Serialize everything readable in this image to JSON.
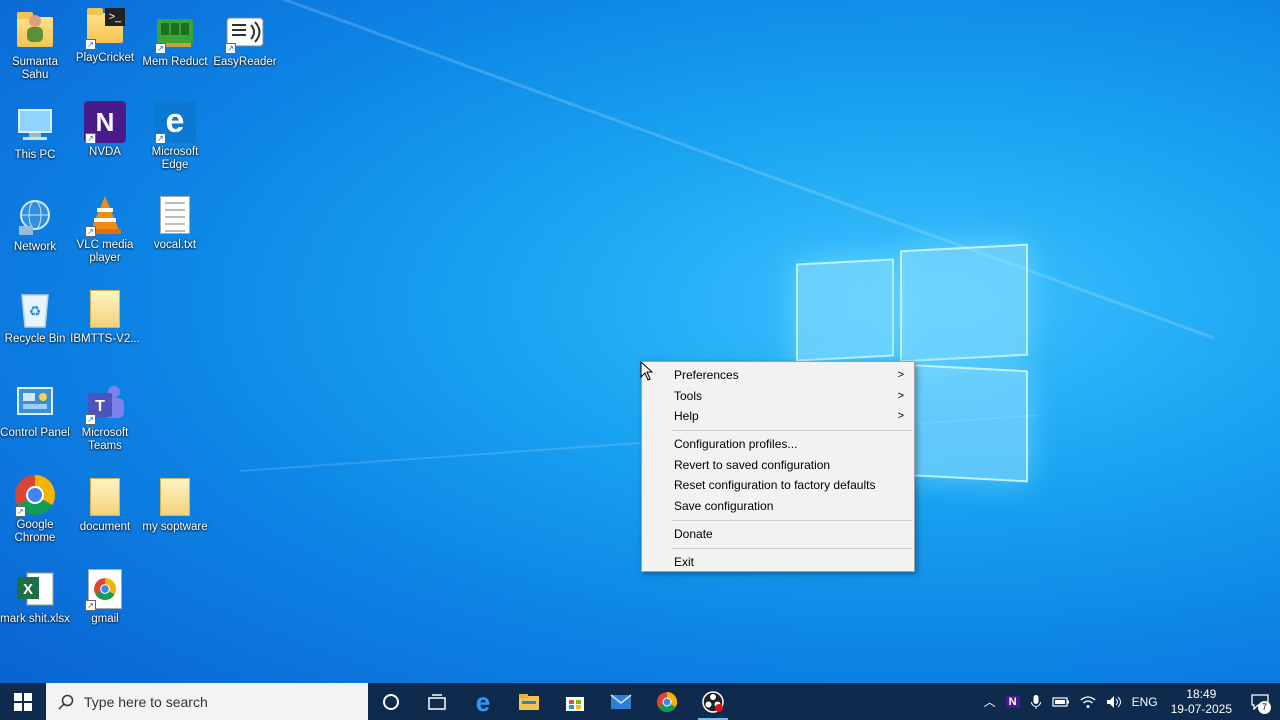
{
  "desktop": {
    "icons": [
      {
        "label": "Sumanta Sahu",
        "icon": "user-folder-icon"
      },
      {
        "label": "PlayCricket",
        "icon": "folder-app-icon"
      },
      {
        "label": "Mem Reduct",
        "icon": "memory-icon"
      },
      {
        "label": "EasyReader",
        "icon": "reader-icon"
      },
      {
        "label": "This PC",
        "icon": "computer-icon"
      },
      {
        "label": "NVDA",
        "icon": "nvda-icon"
      },
      {
        "label": "Microsoft Edge",
        "icon": "edge-icon"
      },
      {
        "label": "Network",
        "icon": "network-icon"
      },
      {
        "label": "VLC media player",
        "icon": "vlc-icon"
      },
      {
        "label": "vocal.txt",
        "icon": "text-file-icon"
      },
      {
        "label": "Recycle Bin",
        "icon": "recycle-bin-icon"
      },
      {
        "label": "IBMTTS-V2...",
        "icon": "folder-icon"
      },
      {
        "label": "Control Panel",
        "icon": "control-panel-icon"
      },
      {
        "label": "Microsoft Teams",
        "icon": "teams-icon"
      },
      {
        "label": "Google Chrome",
        "icon": "chrome-icon"
      },
      {
        "label": "document",
        "icon": "folder-icon"
      },
      {
        "label": "my soptware",
        "icon": "folder-icon"
      },
      {
        "label": "mark shit.xlsx",
        "icon": "excel-icon"
      },
      {
        "label": "gmail",
        "icon": "chrome-shortcut-icon"
      }
    ]
  },
  "context_menu": {
    "items": [
      {
        "label": "Preferences",
        "submenu": true
      },
      {
        "label": "Tools",
        "submenu": true
      },
      {
        "label": "Help",
        "submenu": true
      },
      {
        "label": "Configuration profiles..."
      },
      {
        "label": "Revert to saved configuration"
      },
      {
        "label": "Reset configuration to factory defaults"
      },
      {
        "label": "Save configuration"
      },
      {
        "label": "Donate"
      },
      {
        "label": "Exit"
      }
    ],
    "arrow": ">"
  },
  "taskbar": {
    "search_placeholder": "Type here to search",
    "pinned": [
      "cortana-icon",
      "task-view-icon",
      "edge-icon",
      "file-explorer-icon",
      "store-icon",
      "mail-icon",
      "chrome-icon",
      "obs-icon"
    ],
    "tray": {
      "language": "ENG",
      "time": "18:49",
      "date": "19-07-2025",
      "notification_count": "7"
    }
  },
  "colors": {
    "taskbar_bg": "#0e2b4e",
    "menu_bg": "#f2f2f2",
    "desktop_accent": "#1aa5f2"
  }
}
